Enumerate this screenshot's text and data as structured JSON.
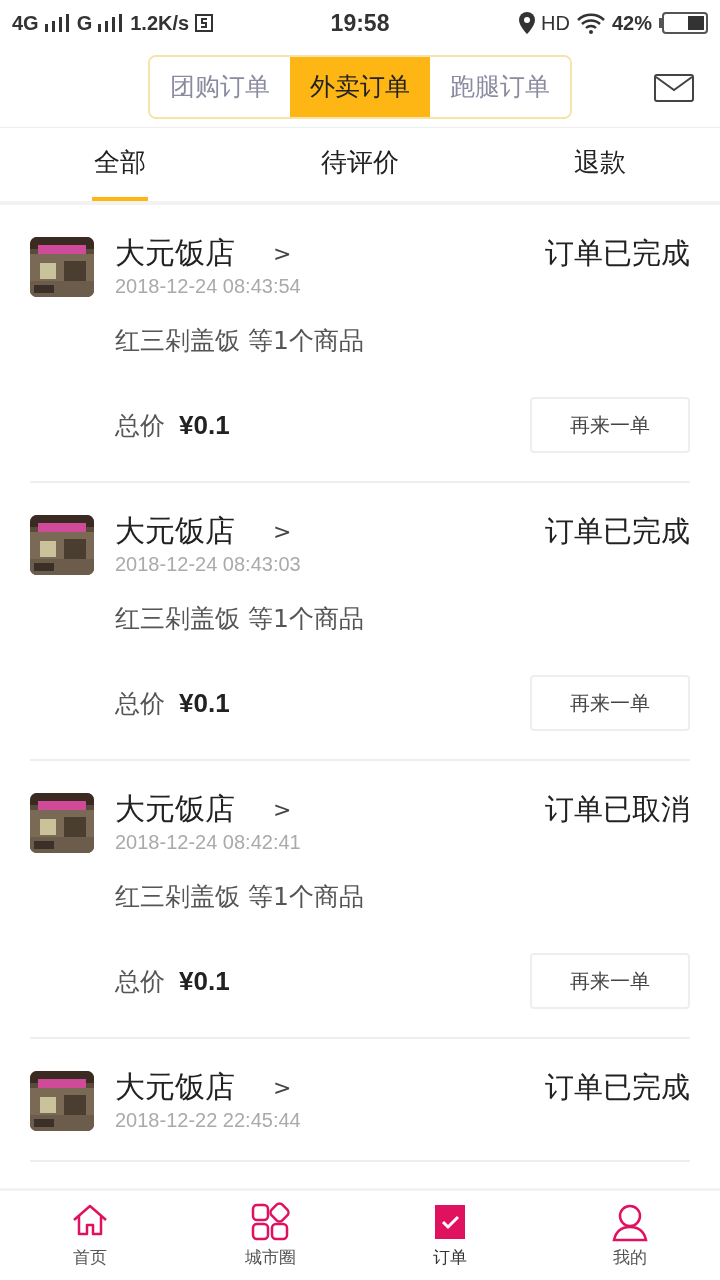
{
  "status_bar": {
    "network_1": "4G",
    "network_2": "G",
    "speed": "1.2K/s",
    "time": "19:58",
    "hd": "HD",
    "battery": "42%"
  },
  "order_types": [
    {
      "label": "团购订单",
      "selected": false
    },
    {
      "label": "外卖订单",
      "selected": true
    },
    {
      "label": "跑腿订单",
      "selected": false
    }
  ],
  "filter_tabs": [
    {
      "label": "全部",
      "selected": true
    },
    {
      "label": "待评价",
      "selected": false
    },
    {
      "label": "退款",
      "selected": false
    }
  ],
  "orders": [
    {
      "store": "大元饭店",
      "chevron": ">",
      "time": "2018-12-24 08:43:54",
      "status": "订单已完成",
      "items": "红三剁盖饭 等1个商品",
      "total_label": "总价",
      "total": "¥0.1",
      "button": "再来一单"
    },
    {
      "store": "大元饭店",
      "chevron": ">",
      "time": "2018-12-24 08:43:03",
      "status": "订单已完成",
      "items": "红三剁盖饭 等1个商品",
      "total_label": "总价",
      "total": "¥0.1",
      "button": "再来一单"
    },
    {
      "store": "大元饭店",
      "chevron": ">",
      "time": "2018-12-24 08:42:41",
      "status": "订单已取消",
      "items": "红三剁盖饭 等1个商品",
      "total_label": "总价",
      "total": "¥0.1",
      "button": "再来一单"
    },
    {
      "store": "大元饭店",
      "chevron": ">",
      "time": "2018-12-22 22:45:44",
      "status": "订单已完成"
    }
  ],
  "bottom_nav": [
    {
      "kind": "home",
      "label": "首页",
      "selected": false
    },
    {
      "kind": "circle",
      "label": "城市圈",
      "selected": false
    },
    {
      "kind": "orders",
      "label": "订单",
      "selected": true
    },
    {
      "kind": "me",
      "label": "我的",
      "selected": false
    }
  ]
}
